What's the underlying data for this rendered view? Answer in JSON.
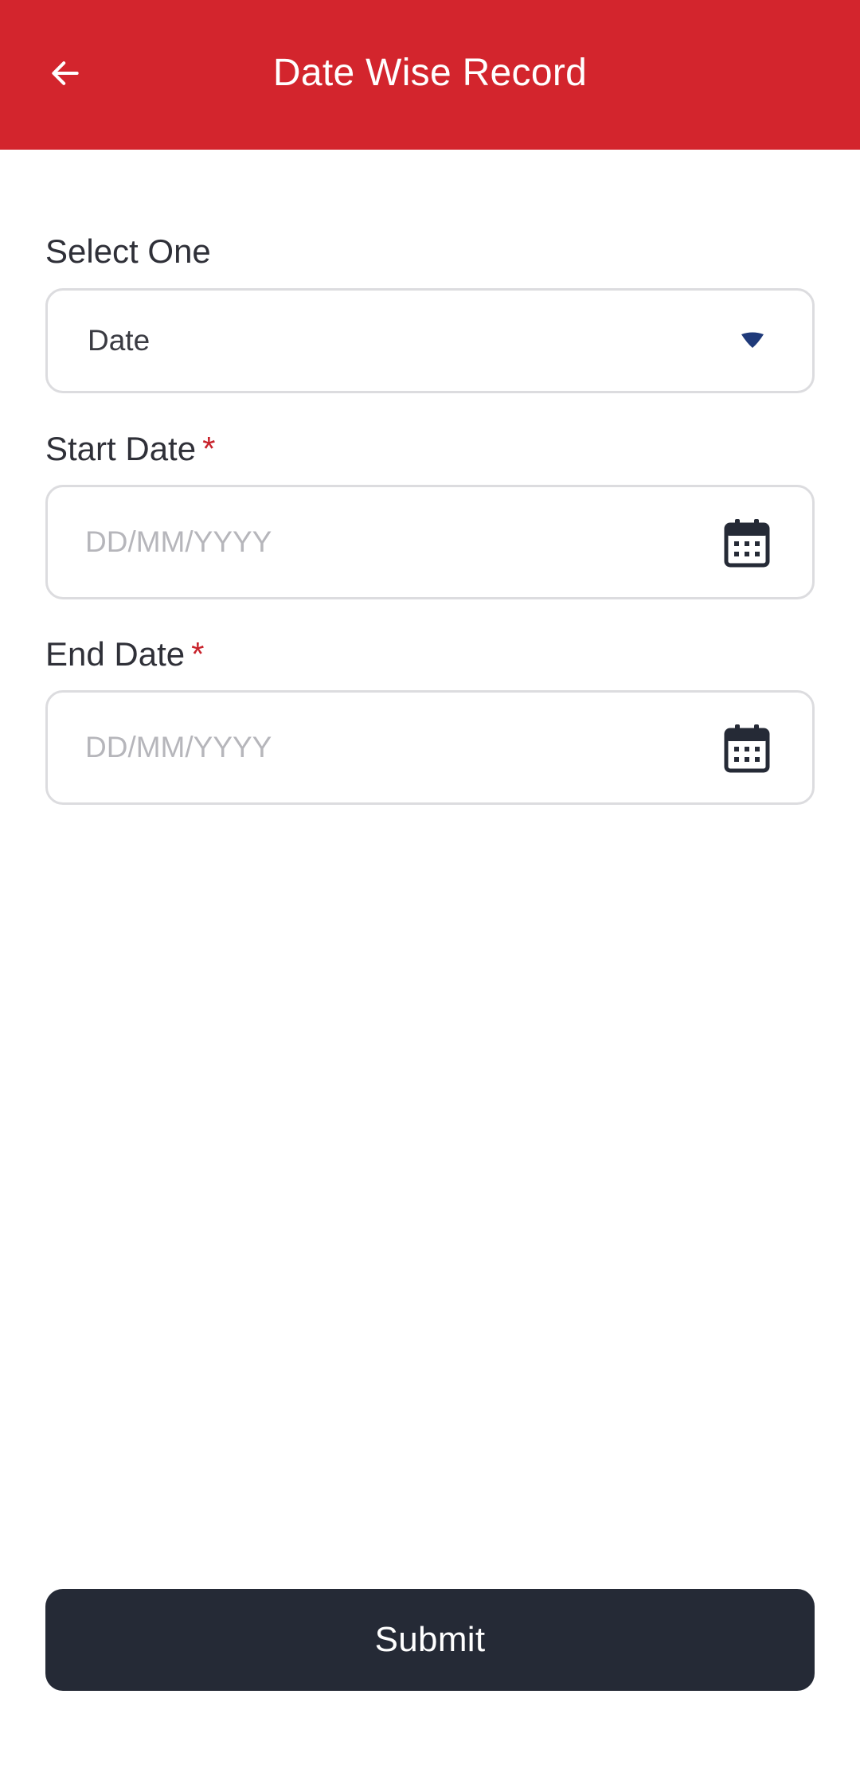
{
  "header": {
    "title": "Date Wise Record",
    "back_icon": "arrow-left-icon",
    "background_color": "#d3252d"
  },
  "form": {
    "select": {
      "label": "Select One",
      "value": "Date",
      "caret_icon": "caret-down-icon",
      "caret_color": "#1f3a7a"
    },
    "start_date": {
      "label": "Start Date",
      "required_mark": "*",
      "placeholder": "DD/MM/YYYY",
      "value": "",
      "icon": "calendar-icon"
    },
    "end_date": {
      "label": "End Date",
      "required_mark": "*",
      "placeholder": "DD/MM/YYYY",
      "value": "",
      "icon": "calendar-icon"
    }
  },
  "submit": {
    "label": "Submit",
    "background_color": "#252a36"
  }
}
